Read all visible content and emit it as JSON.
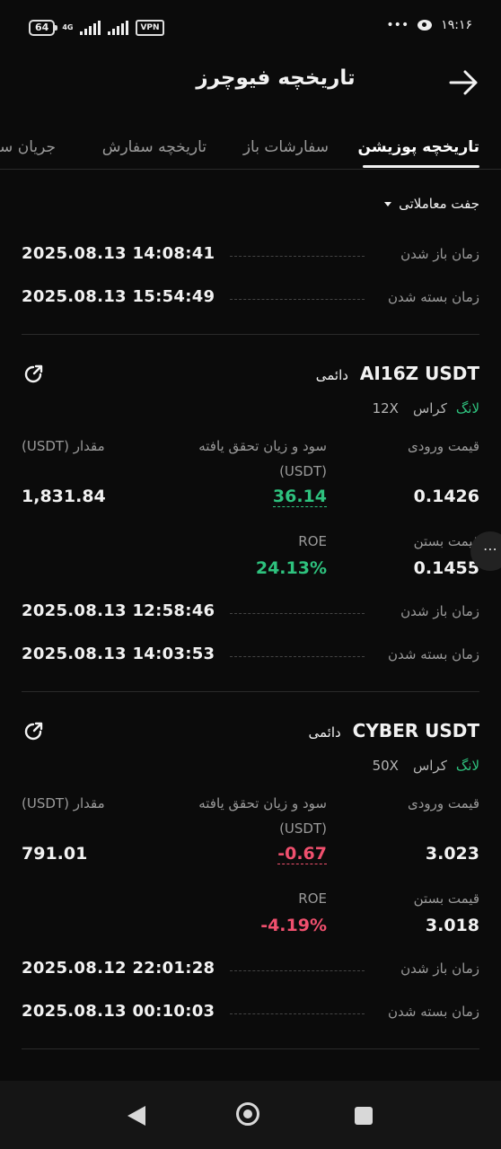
{
  "status": {
    "battery": "64",
    "network": "4G",
    "vpn": "VPN",
    "dots": "•••",
    "time": "۱۹:۱۶"
  },
  "header": {
    "title": "تاریخچه فیوچرز"
  },
  "tabs": [
    "تاریخچه پوزیشن",
    "سفارشات باز",
    "تاریخچه سفارش",
    "جریان سرمایه"
  ],
  "filter": {
    "label": "جفت معاملاتی"
  },
  "labels": {
    "open_time": "زمان باز شدن",
    "close_time": "زمان بسته شدن",
    "entry_price": "قیمت ورودی",
    "close_price": "قیمت بستن",
    "pnl": "سود و زیان تحقق یافته",
    "pnl_unit": "(USDT)",
    "amount": "مقدار (USDT)",
    "roe": "ROE",
    "long": "لانگ",
    "cross": "کراس",
    "perpetual": "دائمی"
  },
  "first_entry": {
    "open_time": "2025.08.13 14:08:41",
    "close_time": "2025.08.13 15:54:49"
  },
  "cards": [
    {
      "symbol": "AI16Z USDT",
      "leverage": "12X",
      "entry_price": "0.1426",
      "close_price": "0.1455",
      "pnl": "36.14",
      "roe": "24.13%",
      "amount": "1,831.84",
      "open_time": "2025.08.13 12:58:46",
      "close_time": "2025.08.13 14:03:53",
      "pnl_color": "#2ec27e"
    },
    {
      "symbol": "CYBER USDT",
      "leverage": "50X",
      "entry_price": "3.023",
      "close_price": "3.018",
      "pnl": "-0.67",
      "roe": "-4.19%",
      "amount": "791.01",
      "open_time": "2025.08.12 22:01:28",
      "close_time": "2025.08.13 00:10:03",
      "pnl_color": "#f0506e"
    }
  ],
  "colors": {
    "background": "#0b0b0b",
    "positive": "#2ec27e",
    "negative": "#f0506e",
    "muted": "#9a9a9a"
  }
}
